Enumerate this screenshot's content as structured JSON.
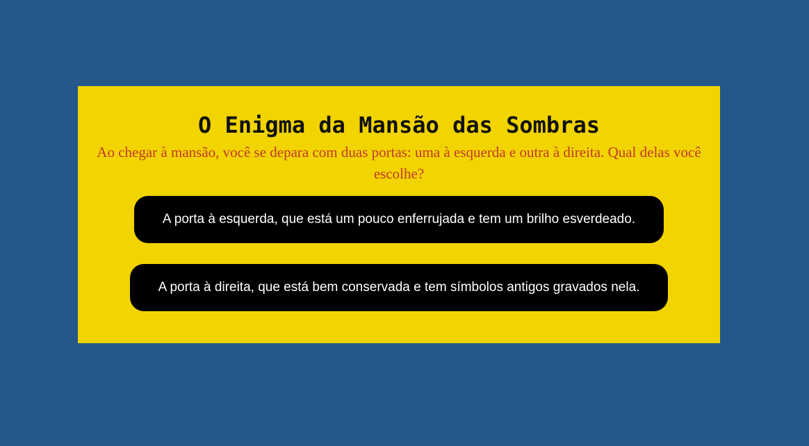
{
  "game": {
    "title": "O Enigma da Mansão das Sombras",
    "prompt": "Ao chegar à mansão, você se depara com duas portas: uma à esquerda e outra à direita. Qual delas você escolhe?",
    "choices": [
      {
        "label": "A porta à esquerda, que está um pouco enferrujada e tem um brilho esverdeado."
      },
      {
        "label": "A porta à direita, que está bem conservada e tem símbolos antigos gravados nela."
      }
    ]
  },
  "colors": {
    "background": "#24588a",
    "card": "#f2d400",
    "title": "#111111",
    "prompt": "#c0392b",
    "button": "#000000",
    "button_text": "#ffffff"
  }
}
